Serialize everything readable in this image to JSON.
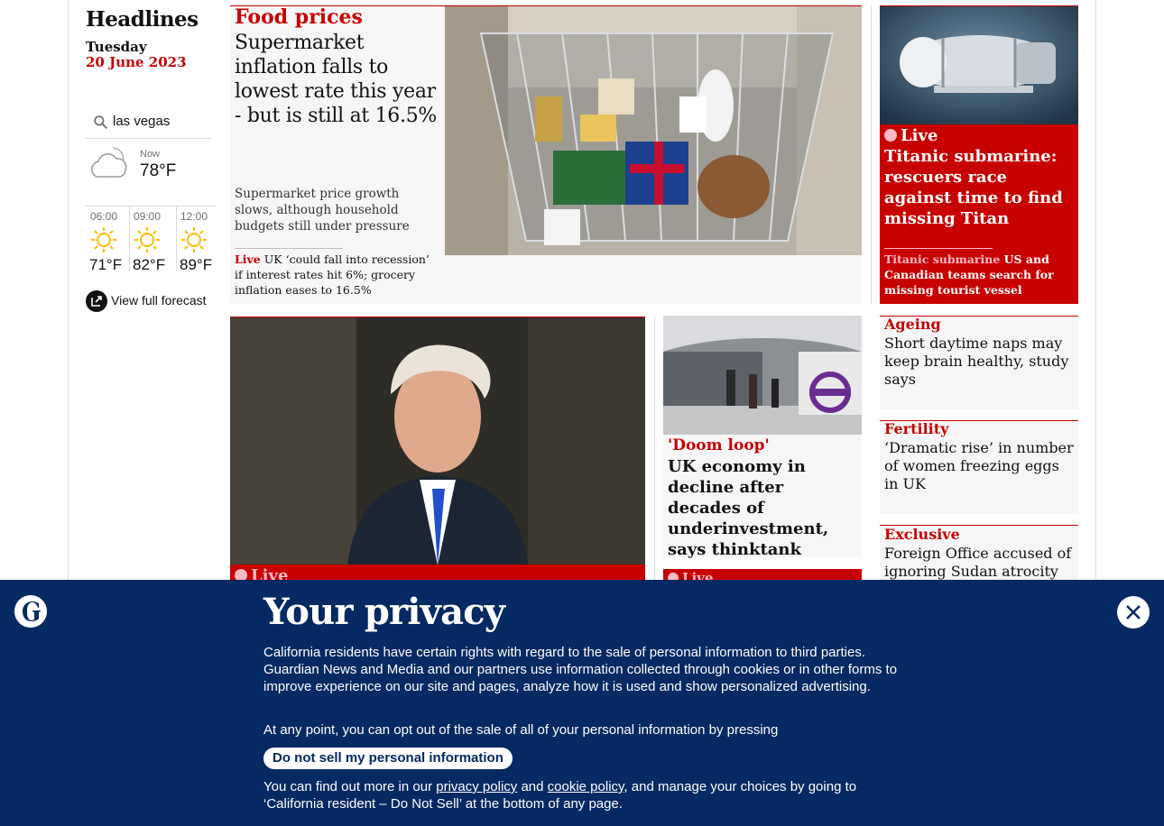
{
  "sidebar": {
    "title": "Headlines",
    "day": "Tuesday",
    "date": "20 June 2023"
  },
  "weather": {
    "location": "las vegas",
    "now_label": "Now",
    "now_temp": "78°F",
    "forecast": [
      {
        "time": "06:00",
        "temp": "71°F",
        "icon": "sun-icon"
      },
      {
        "time": "09:00",
        "temp": "82°F",
        "icon": "sun-icon"
      },
      {
        "time": "12:00",
        "temp": "89°F",
        "icon": "sun-icon"
      }
    ],
    "full_forecast_label": "View full forecast"
  },
  "food": {
    "kicker": "Food prices",
    "headline": "Supermarket inflation falls to lowest rate this year - but is still at 16.5%",
    "standfirst": "Supermarket price growth slows, although household budgets still under pressure",
    "sub_live": "Live",
    "sub_text": "UK ‘could fall into recession’ if interest rates hit 6%; grocery inflation eases to 16.5%"
  },
  "titanic": {
    "live": "Live",
    "headline": "Titanic submarine: rescuers race against time to find missing Titan",
    "sub_kicker": "Titanic submarine",
    "sub_text": "US and Canadian teams search for missing tourist vessel"
  },
  "boris": {
    "live": "Live"
  },
  "doom": {
    "kicker": "'Doom loop'",
    "headline": "UK economy in decline after decades of underinvestment, says thinktank",
    "live": "Live"
  },
  "small_cards": [
    {
      "kicker": "Ageing",
      "headline": "Short daytime naps may keep brain healthy, study says"
    },
    {
      "kicker": "Fertility",
      "headline": "‘Dramatic rise’ in number of women freezing eggs in UK"
    },
    {
      "kicker": "Exclusive",
      "headline": "Foreign Office accused of ignoring Sudan atrocity"
    }
  ],
  "privacy": {
    "title": "Your privacy",
    "p1": "California residents have certain rights with regard to the sale of personal information to third parties. Guardian News and Media and our partners use information collected through cookies or in other forms to improve experience on our site and pages, analyze how it is used and show personalized advertising.",
    "p2": "At any point, you can opt out of the sale of all of your personal information by pressing",
    "button": "Do not sell my personal information",
    "p3_before": "You can find out more in our ",
    "privacy_link": "privacy policy",
    "p3_and": " and ",
    "cookie_link": "cookie policy",
    "p3_after": ", and manage your choices by going to ‘California resident – Do Not Sell’ at the bottom of any page."
  },
  "colors": {
    "news_red": "#c70000",
    "banner_blue": "#052962",
    "card_grey": "#f6f6f6",
    "live_pink": "#ffbac8"
  }
}
